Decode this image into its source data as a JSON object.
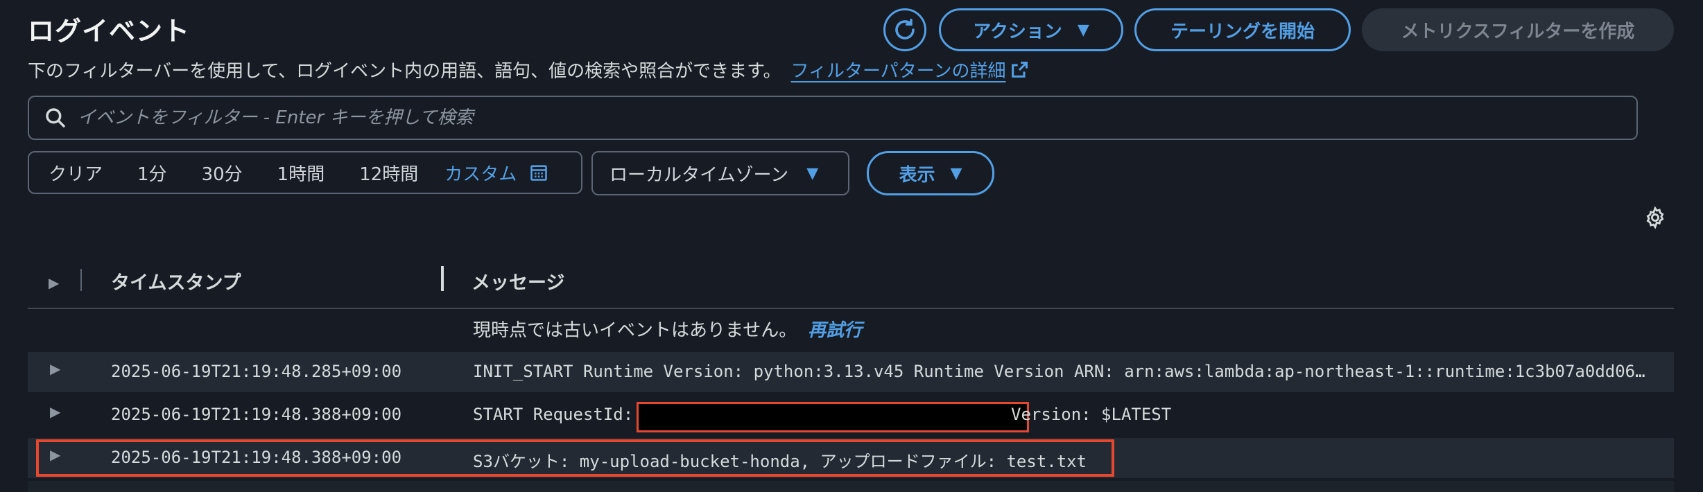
{
  "header": {
    "title": "ログイベント",
    "description": "下のフィルターバーを使用して、ログイベント内の用語、語句、値の検索や照合ができます。",
    "filter_pattern_link": "フィルターパターンの詳細",
    "actions_label": "アクション",
    "tail_label": "テーリングを開始",
    "metric_filter_label": "メトリクスフィルターを作成"
  },
  "search": {
    "placeholder": "イベントをフィルター - Enter キーを押して検索"
  },
  "time_range": {
    "clear": "クリア",
    "options": [
      "1分",
      "30分",
      "1時間",
      "12時間"
    ],
    "custom": "カスタム"
  },
  "timezone": {
    "selected": "ローカルタイムゾーン"
  },
  "view": {
    "label": "表示"
  },
  "table": {
    "columns": {
      "timestamp": "タイムスタンプ",
      "message": "メッセージ"
    },
    "no_older_events": "現時点では古いイベントはありません。",
    "retry": "再試行",
    "rows": [
      {
        "timestamp": "2025-06-19T21:19:48.285+09:00",
        "message": "INIT_START Runtime Version: python:3.13.v45 Runtime Version ARN: arn:aws:lambda:ap-northeast-1::runtime:1c3b07a0dd06…"
      },
      {
        "timestamp": "2025-06-19T21:19:48.388+09:00",
        "message_prefix": "START RequestId:",
        "message_suffix": "Version: $LATEST"
      },
      {
        "timestamp": "2025-06-19T21:19:48.388+09:00",
        "message": "S3バケット: my-upload-bucket-honda, アップロードファイル: test.txt"
      }
    ]
  },
  "colors": {
    "background": "#171c24",
    "accent": "#539fe5",
    "highlight": "#e5482f"
  }
}
